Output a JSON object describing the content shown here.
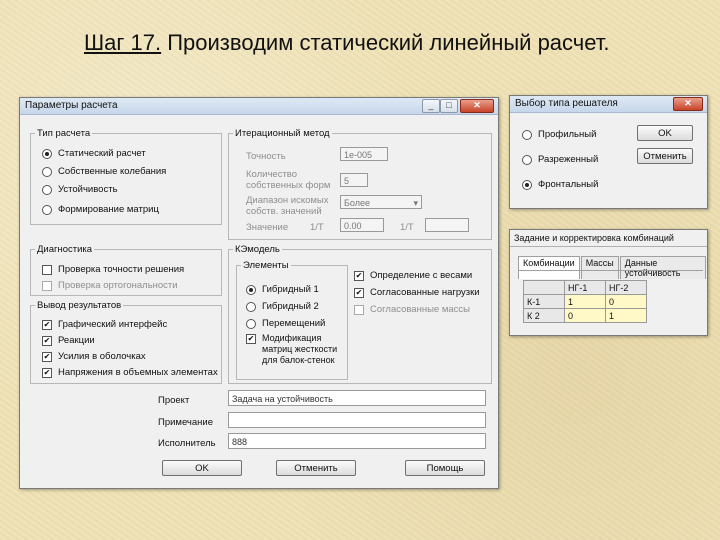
{
  "slide": {
    "title_num": "Шаг 17.",
    "title_rest": " Производим статический линейный расчет."
  },
  "main_dialog": {
    "title": "Параметры расчета",
    "calc_type": {
      "legend": "Тип расчета",
      "options": [
        "Статический расчет",
        "Собственные колебания",
        "Устойчивость",
        "Формирование матриц"
      ],
      "selected_index": 0
    },
    "iter": {
      "legend": "Итерационный метод",
      "accuracy_label": "Точность",
      "accuracy_value": "1e-005",
      "count_label": "Количество собственных форм",
      "count_value": "5",
      "range_label": "Диапазон искомых собств. значений",
      "range_value": "Более",
      "value_label": "Значение",
      "value_unit1": "1/T",
      "value_value": "0.00",
      "value_unit2": "1/T",
      "value_value2": ""
    },
    "diag": {
      "legend": "Диагностика",
      "items": [
        {
          "label": "Проверка точности решения",
          "checked": false,
          "disabled": false
        },
        {
          "label": "Проверка ортогональности",
          "checked": false,
          "disabled": true
        }
      ]
    },
    "output": {
      "legend": "Вывод результатов",
      "items": [
        {
          "label": "Графический интерфейс",
          "checked": true
        },
        {
          "label": "Реакции",
          "checked": true
        },
        {
          "label": "Усилия в оболочках",
          "checked": true
        },
        {
          "label": "Напряжения в объемных элементах",
          "checked": true
        }
      ]
    },
    "model": {
      "legend": "КЭмодель",
      "elements_legend": "Элементы",
      "elements": [
        "Гибридный 1",
        "Гибридный 2",
        "Перемещений"
      ],
      "elements_selected": 0,
      "modify_label": "Модификация матриц жесткости для балок-стенок",
      "modify_checked": true,
      "right_items": [
        {
          "label": "Определение с весами",
          "checked": true,
          "disabled": false
        },
        {
          "label": "Согласованные нагрузки",
          "checked": true,
          "disabled": false
        },
        {
          "label": "Согласованные массы",
          "checked": false,
          "disabled": true
        }
      ]
    },
    "fields": [
      {
        "label": "Проект",
        "value": "Задача на устойчивость"
      },
      {
        "label": "Примечание",
        "value": ""
      },
      {
        "label": "Исполнитель",
        "value": "888"
      }
    ],
    "buttons": {
      "ok": "OK",
      "cancel": "Отменить",
      "help": "Помощь"
    }
  },
  "solver_dialog": {
    "title": "Выбор типа решателя",
    "options": [
      "Профильный",
      "Разреженный",
      "Фронтальный"
    ],
    "selected_index": 2,
    "ok": "OK",
    "cancel": "Отменить"
  },
  "combo_panel": {
    "title": "Задание и корректировка комбинаций",
    "tabs": [
      "Комбинации",
      "Массы",
      "Данные устойчивость"
    ],
    "active_tab": 0,
    "headers": [
      "",
      "НГ-1",
      "НГ-2"
    ],
    "rows": [
      {
        "name": "К-1",
        "values": [
          "1",
          "0"
        ]
      },
      {
        "name": "К 2",
        "values": [
          "0",
          "1"
        ]
      }
    ]
  },
  "icons": {
    "minimize": "minimize-icon",
    "maximize": "maximize-icon",
    "close": "close-icon"
  }
}
